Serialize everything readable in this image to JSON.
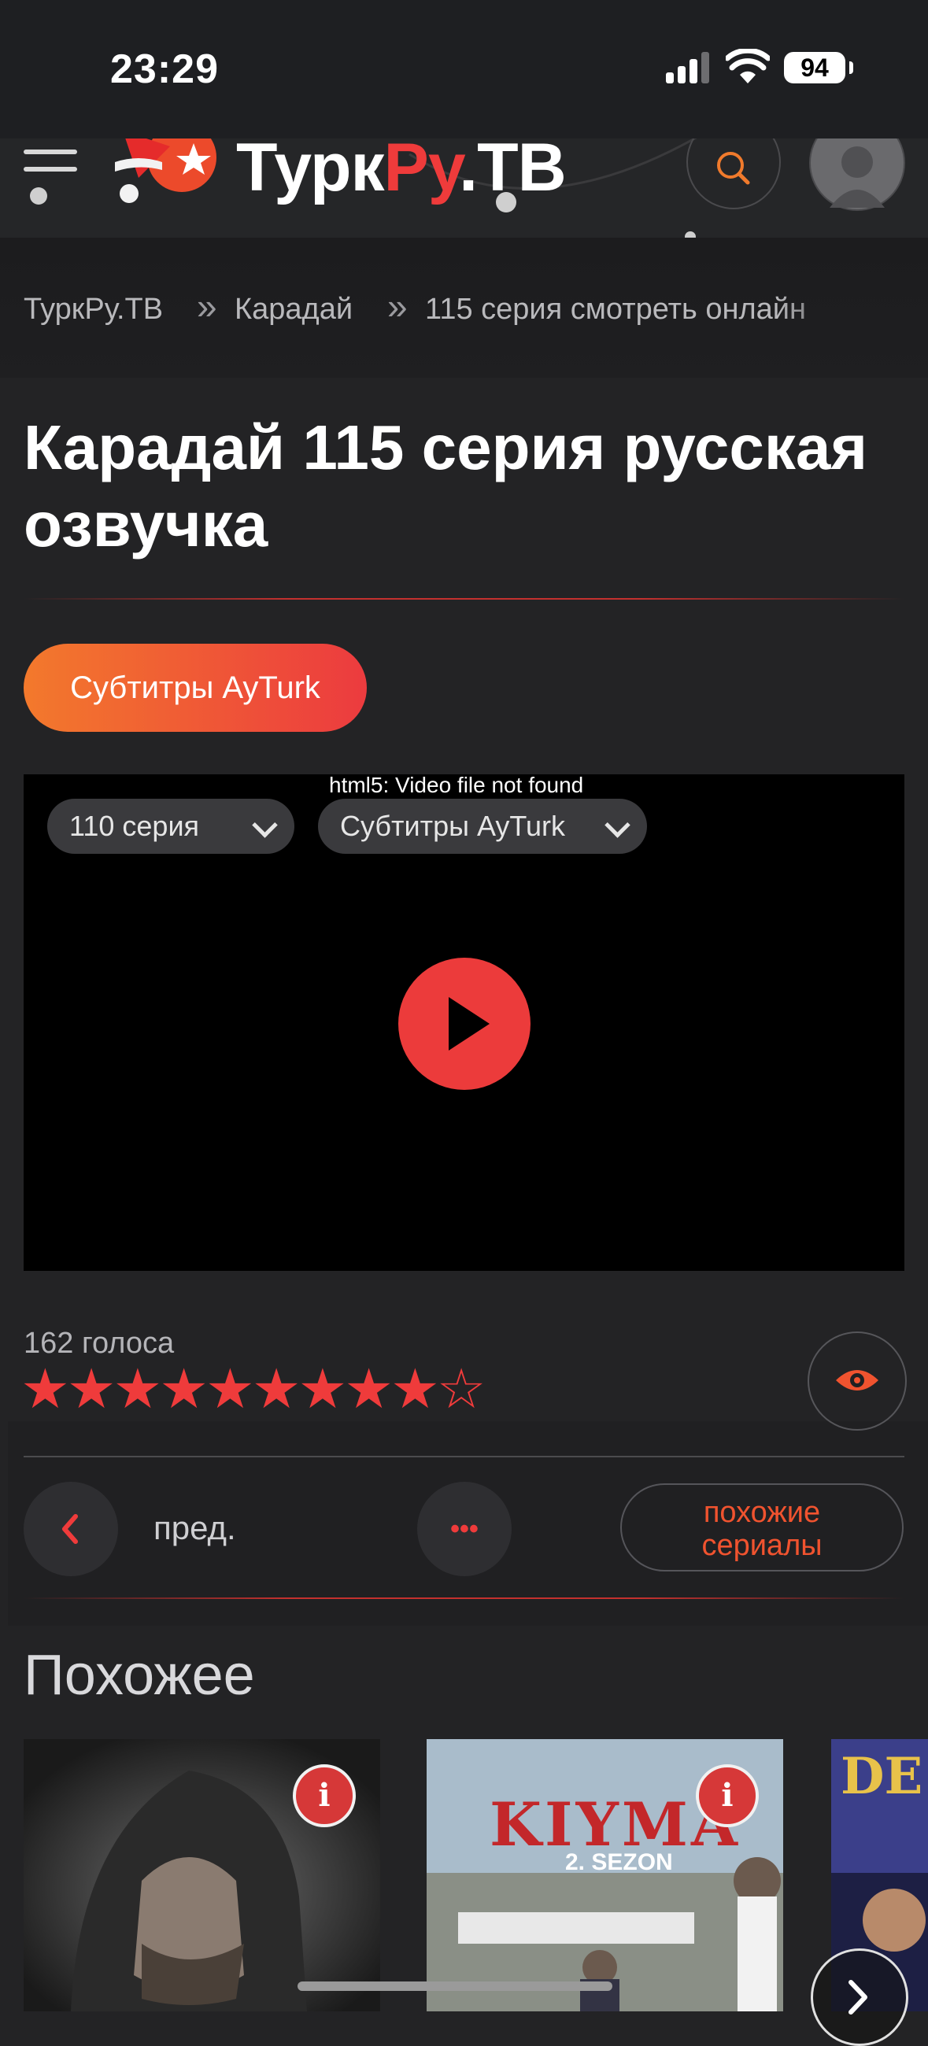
{
  "status": {
    "time": "23:29",
    "battery": "94"
  },
  "header": {
    "logo_part1": "Турк",
    "logo_part2": "Ру",
    "logo_part3": ".ТВ"
  },
  "breadcrumb": [
    "ТуркРу.ТВ",
    "Карадай",
    "115 серия смотреть онлайн"
  ],
  "breadcrumb_sep": "»",
  "title": "Карадай 115 серия русская озвучка",
  "subtitle_button": "Субтитры AyTurk",
  "player": {
    "error": "html5: Video file not found",
    "episode_select": "110 серия",
    "voice_select": "Субтитры AyTurk"
  },
  "rating": {
    "votes": "162 голоса",
    "stars_filled": 9,
    "stars_total": 10,
    "stars": "★★★★★★★★★☆"
  },
  "nav": {
    "prev": "пред.",
    "more": "•••",
    "similar_line1": "похожие",
    "similar_line2": "сериалы"
  },
  "related": {
    "heading": "Похожее",
    "card2_title": "KIYMA",
    "card2_season": "2. SEZON",
    "card3_title": "DE"
  },
  "colors": {
    "accent": "#ef3b3b",
    "orange": "#f3792c",
    "bg": "#232325"
  }
}
